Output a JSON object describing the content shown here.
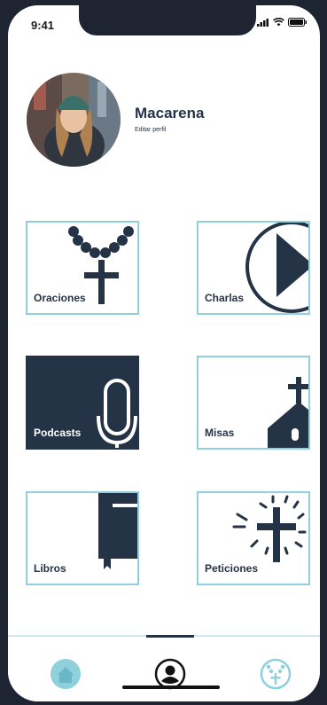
{
  "status_bar": {
    "time": "9:41"
  },
  "profile": {
    "name": "Macarena",
    "edit_label": "Editar perfil"
  },
  "tiles": [
    {
      "label": "Oraciones",
      "icon": "rosary-icon"
    },
    {
      "label": "Charlas",
      "icon": "play-icon"
    },
    {
      "label": "Podcasts",
      "icon": "microphone-icon",
      "selected": true
    },
    {
      "label": "Misas",
      "icon": "church-icon"
    },
    {
      "label": "Libros",
      "icon": "book-icon"
    },
    {
      "label": "Peticiones",
      "icon": "radiant-cross-icon"
    }
  ],
  "tabbar": {
    "tabs": [
      {
        "icon": "home-icon"
      },
      {
        "icon": "user-icon",
        "active": true
      },
      {
        "icon": "rosary-icon"
      }
    ]
  },
  "colors": {
    "navy": "#253346",
    "accent": "#8fd0dd",
    "background": "#1f2432"
  }
}
